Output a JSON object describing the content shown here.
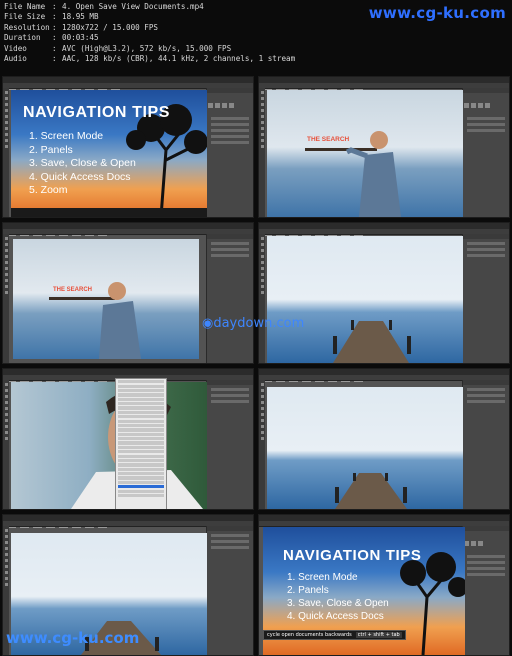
{
  "file_info": {
    "rows": [
      {
        "key": "File Name",
        "value": "4. Open Save View Documents.mp4"
      },
      {
        "key": "File Size",
        "value": "18.95 MB"
      },
      {
        "key": "Resolution",
        "value": "1280x722 / 15.000 FPS"
      },
      {
        "key": "Duration",
        "value": "00:03:45"
      },
      {
        "key": "Video",
        "value": "AVC (High@L3.2), 572 kb/s, 15.000 FPS"
      },
      {
        "key": "Audio",
        "value": "AAC, 128 kb/s (CBR), 44.1 kHz, 2 channels, 1 stream"
      }
    ],
    "separator": ":"
  },
  "watermarks": {
    "top": "www.cg-ku.com",
    "middle": "daydown.com",
    "bottom": "www.cg-ku.com"
  },
  "slide": {
    "title": "NAVIGATION TIPS",
    "items": [
      "1. Screen Mode",
      "2. Panels",
      "3. Save, Close & Open",
      "4. Quick Access Docs",
      "5. Zoom"
    ]
  },
  "search_label": "THE SEARCH",
  "tooltip": {
    "text": "cycle open documents backwards",
    "shortcut": "ctrl + shift + tab"
  },
  "colors": {
    "sky_top": "#2f5fa8",
    "sunset": "#f08a3a",
    "lake": "#3f74a8",
    "search_red": "#e8503a"
  }
}
